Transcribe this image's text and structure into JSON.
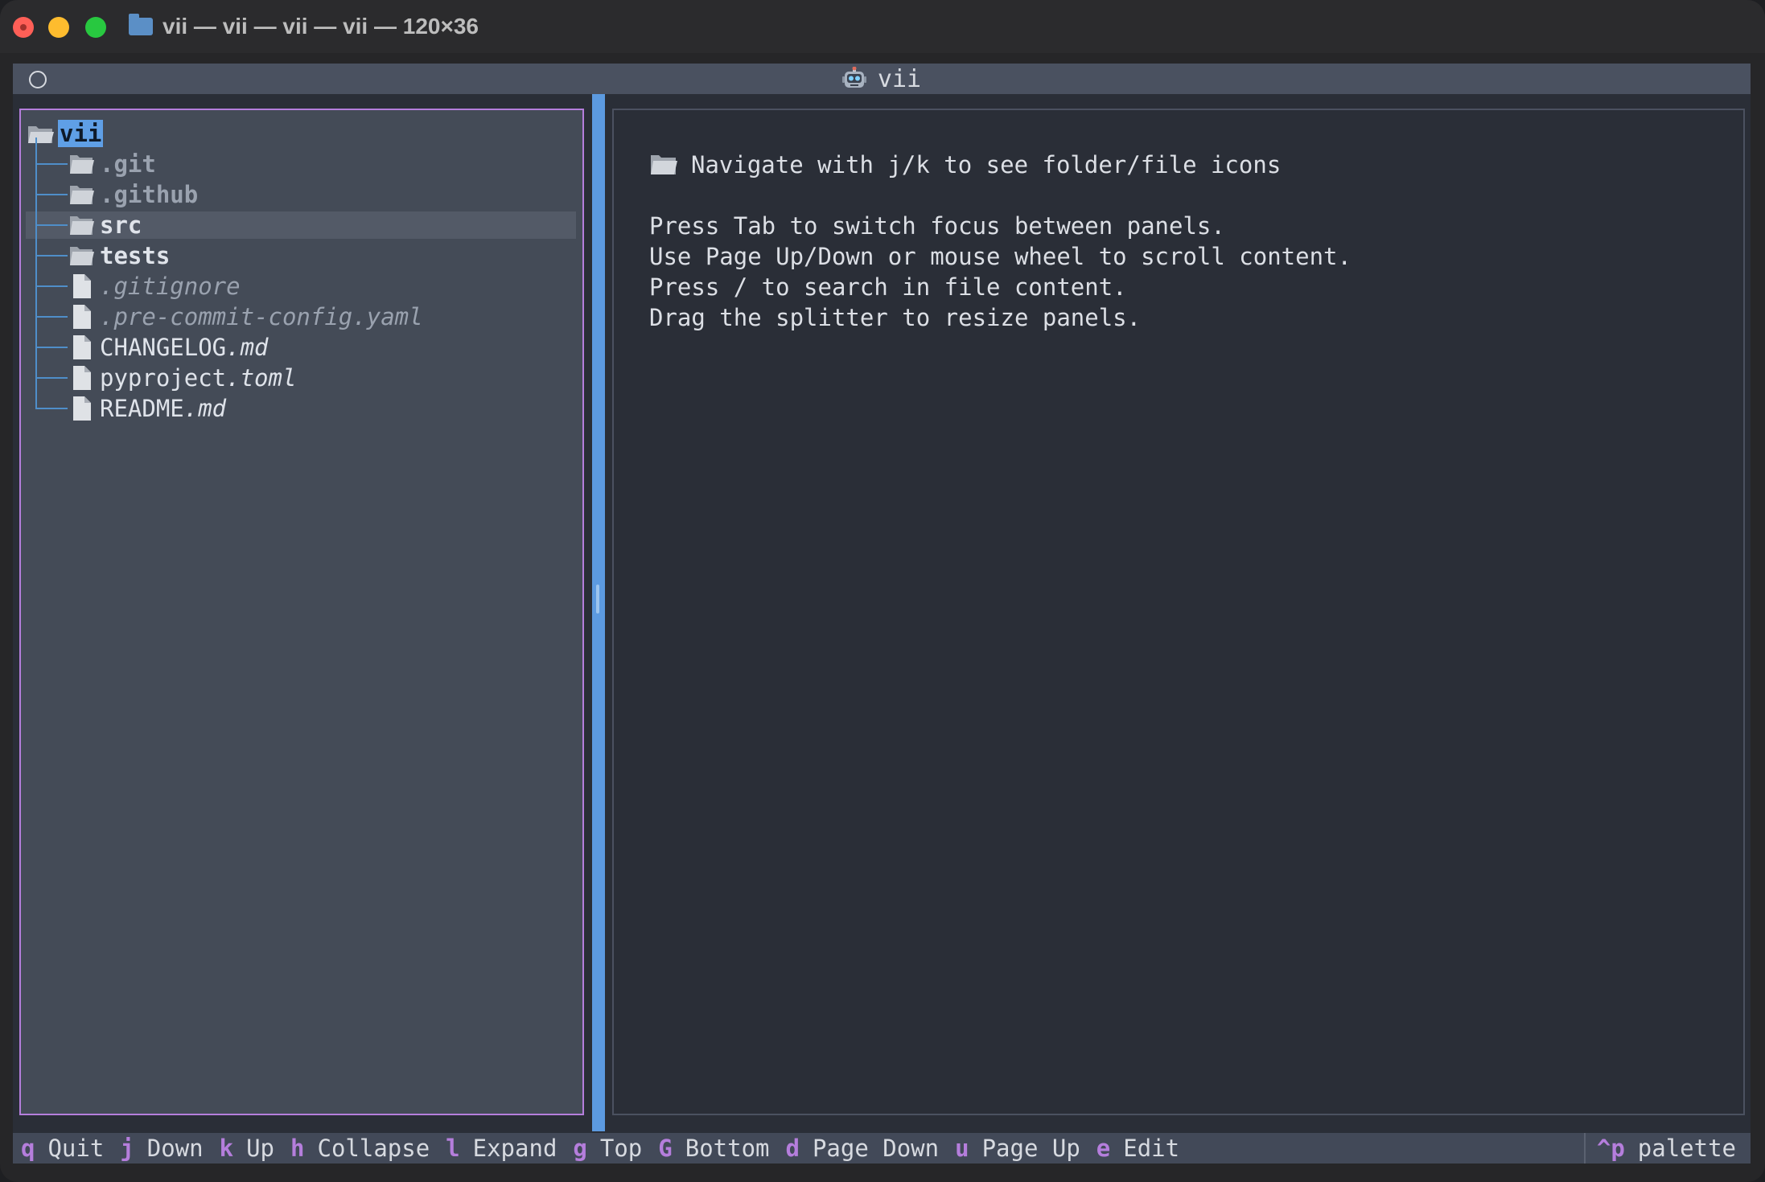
{
  "window": {
    "title": "vii — vii — vii — vii — 120×36"
  },
  "app_header": {
    "title": "vii"
  },
  "tree": {
    "root": "vii",
    "items": [
      {
        "name": ".git",
        "kind": "folder",
        "style": "dim-bold"
      },
      {
        "name": ".github",
        "kind": "folder",
        "style": "dim-bold"
      },
      {
        "name": "src",
        "kind": "folder",
        "style": "bold",
        "selected": true
      },
      {
        "name": "tests",
        "kind": "folder",
        "style": "bold"
      },
      {
        "name": ".gitignore",
        "kind": "file",
        "style": "dim-italic"
      },
      {
        "name": ".pre-commit-config.yaml",
        "kind": "file",
        "style": "dim-italic"
      },
      {
        "name": "CHANGELOG",
        "ext": ".md",
        "kind": "file",
        "style": "normal"
      },
      {
        "name": "pyproject",
        "ext": ".toml",
        "kind": "file",
        "style": "normal"
      },
      {
        "name": "README",
        "ext": ".md",
        "kind": "file",
        "style": "normal"
      }
    ]
  },
  "preview": {
    "heading": "Navigate with j/k to see folder/file icons",
    "lines": [
      "Press Tab to switch focus between panels.",
      "Use Page Up/Down or mouse wheel to scroll content.",
      "Press / to search in file content.",
      "Drag the splitter to resize panels."
    ]
  },
  "footer": {
    "bindings": [
      {
        "key": "q",
        "label": "Quit"
      },
      {
        "key": "j",
        "label": "Down"
      },
      {
        "key": "k",
        "label": "Up"
      },
      {
        "key": "h",
        "label": "Collapse"
      },
      {
        "key": "l",
        "label": "Expand"
      },
      {
        "key": "g",
        "label": "Top"
      },
      {
        "key": "G",
        "label": "Bottom"
      },
      {
        "key": "d",
        "label": "Page Down"
      },
      {
        "key": "u",
        "label": "Page Up"
      },
      {
        "key": "e",
        "label": "Edit"
      }
    ],
    "palette": {
      "key": "^p",
      "label": "palette"
    }
  },
  "colors": {
    "accent_purple": "#b57edc",
    "splitter_blue": "#5c9ae0",
    "tree_line_blue": "#4f8ec9",
    "root_highlight": "#5f9fe6"
  }
}
